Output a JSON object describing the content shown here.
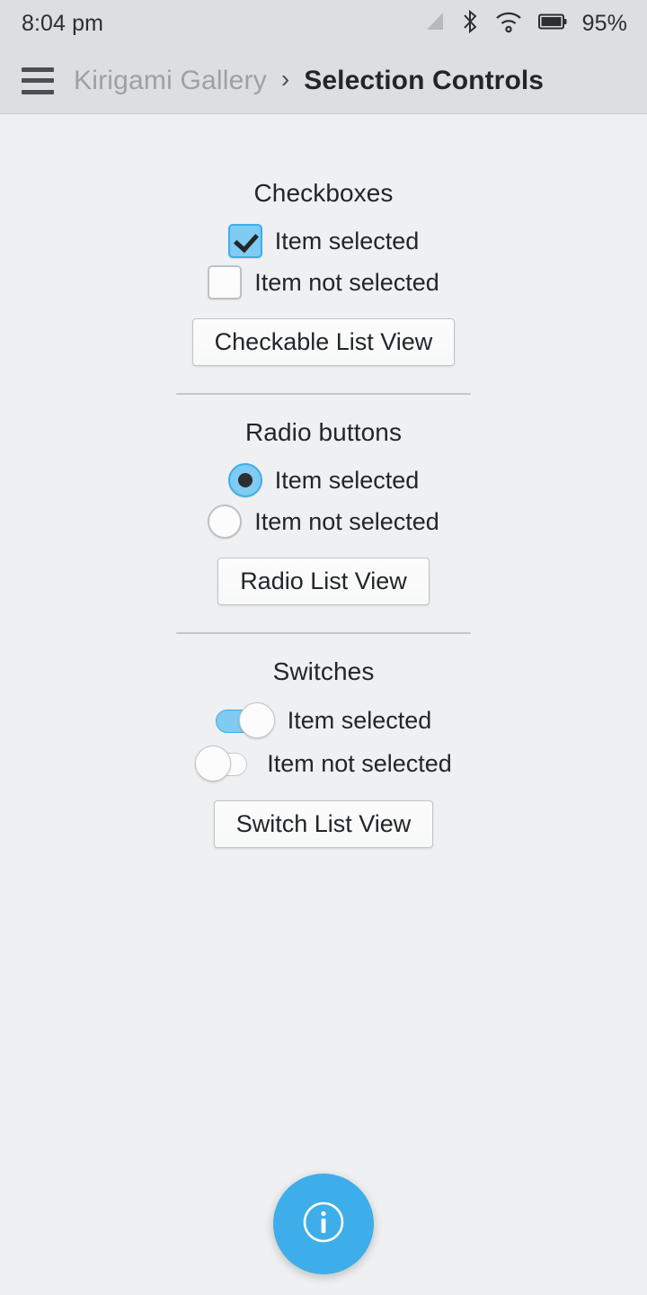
{
  "statusbar": {
    "clock": "8:04 pm",
    "battery_percent": "95%",
    "icons": [
      "signal-icon",
      "bluetooth-icon",
      "wifi-icon",
      "battery-icon"
    ]
  },
  "toolbar": {
    "menu_icon": "hamburger-menu-icon",
    "breadcrumb_root": "Kirigami Gallery",
    "breadcrumb_separator": "›",
    "breadcrumb_current": "Selection Controls"
  },
  "sections": [
    {
      "title": "Checkboxes",
      "items": [
        {
          "label": "Item selected",
          "checked": true
        },
        {
          "label": "Item not selected",
          "checked": false
        }
      ],
      "button": "Checkable List View"
    },
    {
      "title": "Radio buttons",
      "items": [
        {
          "label": "Item selected",
          "checked": true
        },
        {
          "label": "Item not selected",
          "checked": false
        }
      ],
      "button": "Radio List View"
    },
    {
      "title": "Switches",
      "items": [
        {
          "label": "Item selected",
          "checked": true
        },
        {
          "label": "Item not selected",
          "checked": false
        }
      ],
      "button": "Switch List View"
    }
  ],
  "fab": {
    "icon": "info-icon",
    "color": "#3daee9"
  },
  "colors": {
    "background": "#eff0f1",
    "chrome": "#dcdedf",
    "accent": "#3daee9",
    "accent_light": "#7fcbf2",
    "text": "#232629",
    "text_muted": "#9da1a5",
    "separator": "#c4c7ca"
  }
}
